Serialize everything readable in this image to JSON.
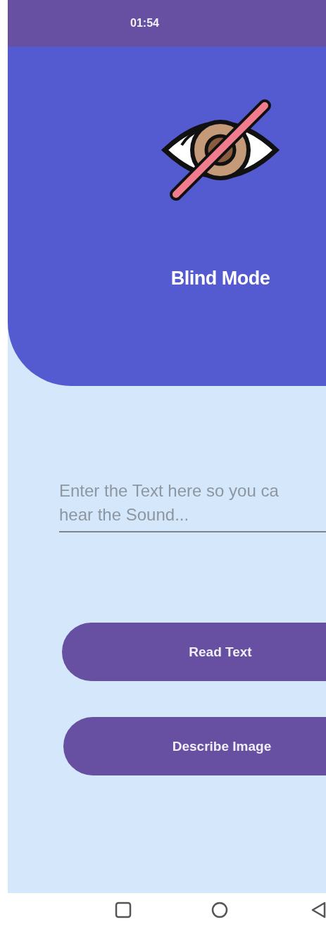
{
  "status_bar": {
    "time": "01:54"
  },
  "header": {
    "title": "Blind Mode"
  },
  "text_field": {
    "placeholder": "Enter the Text here so you ca\nhear the Sound..."
  },
  "buttons": [
    {
      "label": "Read Text"
    },
    {
      "label": "Describe Image"
    }
  ]
}
